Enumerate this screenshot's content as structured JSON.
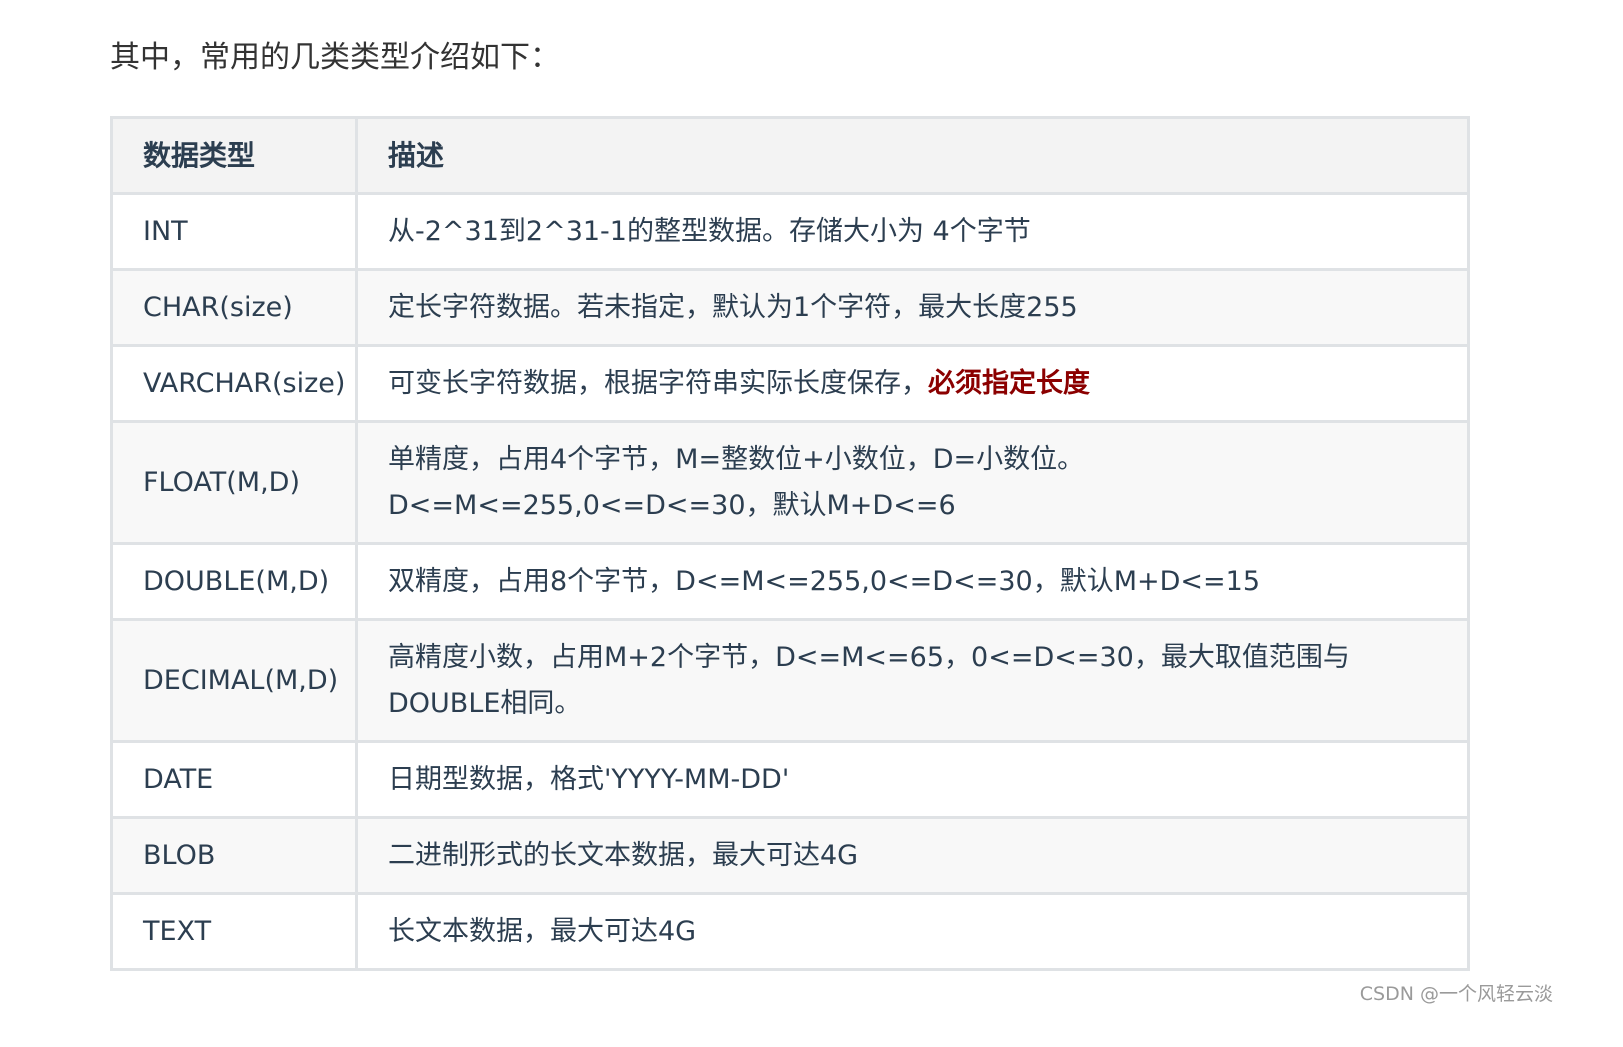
{
  "intro_text": "其中，常用的几类类型介绍如下：",
  "table": {
    "headers": [
      "数据类型",
      "描述"
    ],
    "rows": [
      {
        "type": "INT",
        "description": "从-2^31到2^31-1的整型数据。存储大小为 4个字节",
        "emphasis": ""
      },
      {
        "type": "CHAR(size)",
        "description": "定长字符数据。若未指定，默认为1个字符，最大长度255",
        "emphasis": ""
      },
      {
        "type": "VARCHAR(size)",
        "description": "可变长字符数据，根据字符串实际长度保存，",
        "emphasis": "必须指定长度"
      },
      {
        "type": "FLOAT(M,D)",
        "description": "单精度，占用4个字节，M=整数位+小数位，D=小数位。 D<=M<=255,0<=D<=30，默认M+D<=6",
        "emphasis": ""
      },
      {
        "type": "DOUBLE(M,D)",
        "description": "双精度，占用8个字节，D<=M<=255,0<=D<=30，默认M+D<=15",
        "emphasis": ""
      },
      {
        "type": "DECIMAL(M,D)",
        "description": "高精度小数，占用M+2个字节，D<=M<=65，0<=D<=30，最大取值范围与DOUBLE相同。",
        "emphasis": ""
      },
      {
        "type": "DATE",
        "description": "日期型数据，格式'YYYY-MM-DD'",
        "emphasis": ""
      },
      {
        "type": "BLOB",
        "description": "二进制形式的长文本数据，最大可达4G",
        "emphasis": ""
      },
      {
        "type": "TEXT",
        "description": "长文本数据，最大可达4G",
        "emphasis": ""
      }
    ]
  },
  "watermark": "CSDN @一个风轻云淡",
  "colors": {
    "emphasis": "#8b0000",
    "header_bg": "#f3f3f3",
    "stripe_bg": "#f8f8f8",
    "border": "#dfe2e5",
    "text": "#2c3e50"
  }
}
